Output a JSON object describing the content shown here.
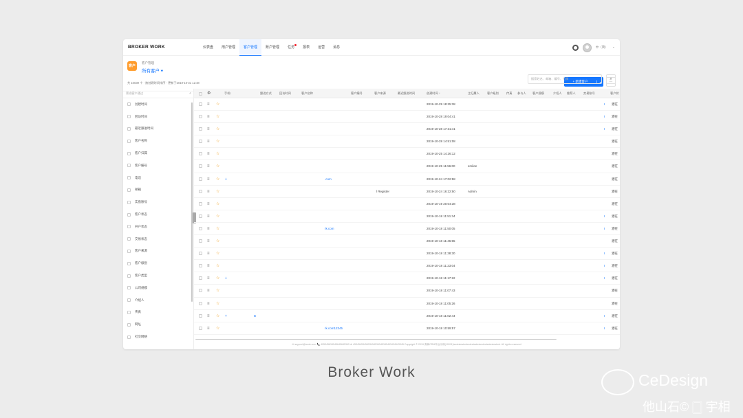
{
  "app": {
    "brand": "BROKER WORK"
  },
  "nav": [
    {
      "label": "仪表盘",
      "active": false,
      "badge": false
    },
    {
      "label": "用户管理",
      "active": false,
      "badge": false
    },
    {
      "label": "客户管理",
      "active": true,
      "badge": false
    },
    {
      "label": "账户管理",
      "active": false,
      "badge": false
    },
    {
      "label": "任务",
      "active": false,
      "badge": true
    },
    {
      "label": "报表",
      "active": false,
      "badge": false
    },
    {
      "label": "运营",
      "active": false,
      "badge": false
    },
    {
      "label": "消息",
      "active": false,
      "badge": false
    }
  ],
  "top_right": {
    "lang": "中（简）",
    "chevron": "⌄"
  },
  "header": {
    "icon_text": "客户",
    "breadcrumb": "客户管理",
    "view_title": "所有客户 ▾",
    "meta": "共 10039 个 · 按创建时间排序 · 更新于2019-10-31 12:48",
    "new_button": "+ 新建客户",
    "new_arrow": "▾",
    "more": "···",
    "search_placeholder": "搜索姓名、邮箱、编号、归属",
    "search_icon": "⌕"
  },
  "sidebar": {
    "filter_placeholder": "筛选客户通过",
    "items": [
      "创建时间",
      "回访时间",
      "最近跟进时间",
      "客户名称",
      "客户归属",
      "客户编号",
      "电话",
      "邮箱",
      "实盘账号",
      "客户状态",
      "开户状态",
      "交易状态",
      "客户来源",
      "客户级别",
      "客户类型",
      "公司规模",
      "介绍人",
      "传真",
      "网址",
      "社交网络"
    ]
  },
  "table": {
    "columns": [
      "手机↑",
      "跟进方式",
      "回访时间",
      "客户名称",
      "客户编号",
      "客户来源",
      "最近跟进时间",
      "创建时间 ↓",
      "主归属人",
      "客户级别",
      "传真",
      "参与人",
      "客户规模",
      "介绍人",
      "推荐人",
      "交易账号",
      "客户状"
    ],
    "rows": [
      {
        "plus": "",
        "name": "",
        "source": "",
        "created": "2019-10-29 18:25:38",
        "owner": "",
        "mark": "ı",
        "status": "潜在"
      },
      {
        "plus": "",
        "name": "",
        "source": "",
        "created": "2019-10-28 19:04:41",
        "owner": "",
        "mark": "ı",
        "status": "潜在"
      },
      {
        "plus": "",
        "name": "",
        "source": "",
        "created": "2019-10-28 17:31:41",
        "owner": "",
        "mark": "ı",
        "status": "潜在"
      },
      {
        "plus": "",
        "name": "",
        "source": "",
        "created": "2019-10-28 14:51:08",
        "owner": "",
        "mark": "",
        "status": "潜在"
      },
      {
        "plus": "",
        "name": "",
        "source": "",
        "created": "2019-10-25 14:26:12",
        "owner": "",
        "mark": "",
        "status": "潜在"
      },
      {
        "plus": "",
        "name": "",
        "source": "",
        "created": "2019-10-25 11:56:00",
        "owner": "emilee",
        "mark": "",
        "status": "潜在"
      },
      {
        "plus": "+",
        "name": ".com",
        "source": "",
        "created": "2019-10-24 17:02:58",
        "owner": "",
        "mark": "",
        "status": "潜在"
      },
      {
        "plus": "",
        "name": "",
        "source": "l Register",
        "created": "2019-10-24 16:22:50",
        "owner": "Admin",
        "mark": "",
        "status": "潜在"
      },
      {
        "plus": "",
        "name": "",
        "source": "",
        "created": "2019-10-19 20:04:38",
        "owner": "",
        "mark": "",
        "status": "潜在"
      },
      {
        "plus": "",
        "name": "",
        "source": "",
        "created": "2019-10-18 11:51:34",
        "owner": "",
        "mark": "ı",
        "status": "潜在"
      },
      {
        "plus": "",
        "name": "rk.com",
        "source": "",
        "created": "2019-10-18 11:50:05",
        "owner": "",
        "mark": "ı",
        "status": "潜在"
      },
      {
        "plus": "",
        "name": "",
        "source": "",
        "created": "2019-10-18 11:46:55",
        "owner": "",
        "mark": "",
        "status": "潜在"
      },
      {
        "plus": "",
        "name": "",
        "source": "",
        "created": "2019-10-18 11:38:30",
        "owner": "",
        "mark": "ı",
        "status": "潜在"
      },
      {
        "plus": "",
        "name": "",
        "source": "",
        "created": "2019-10-18 11:23:04",
        "owner": "",
        "mark": "ı",
        "status": "潜在"
      },
      {
        "plus": "+",
        "name": "",
        "source": "",
        "created": "2019-10-18 11:17:22",
        "owner": "",
        "mark": "ı",
        "status": "潜在"
      },
      {
        "plus": "",
        "name": "",
        "source": "",
        "created": "2019-10-18 11:07:43",
        "owner": "",
        "mark": "",
        "status": "潜在"
      },
      {
        "plus": "",
        "name": "",
        "source": "",
        "created": "2019-10-18 11:05:26",
        "owner": "",
        "mark": "",
        "status": "潜在"
      },
      {
        "plus": "+",
        "name": "",
        "follow": "B",
        "source": "",
        "created": "2019-10-18 11:02:44",
        "owner": "",
        "mark": "ı",
        "status": "潜在"
      },
      {
        "plus": "",
        "name": "rk.com12345",
        "source": "",
        "created": "2019-10-18 10:59:57",
        "owner": "",
        "mark": "ı",
        "status": "潜在"
      }
    ]
  },
  "footer": "✉ support@work.com  📞 495345634545645645345  ⊕ 4534545345453454534545345453434543345  Copyright © 2019 券商CRM平台示例(10011)testestestestestestestestestestestestestest. All rights reserved.",
  "caption": "Broker Work",
  "watermark": {
    "brand": "CeDesign",
    "line2": "他山石© 🀆 宇相"
  }
}
